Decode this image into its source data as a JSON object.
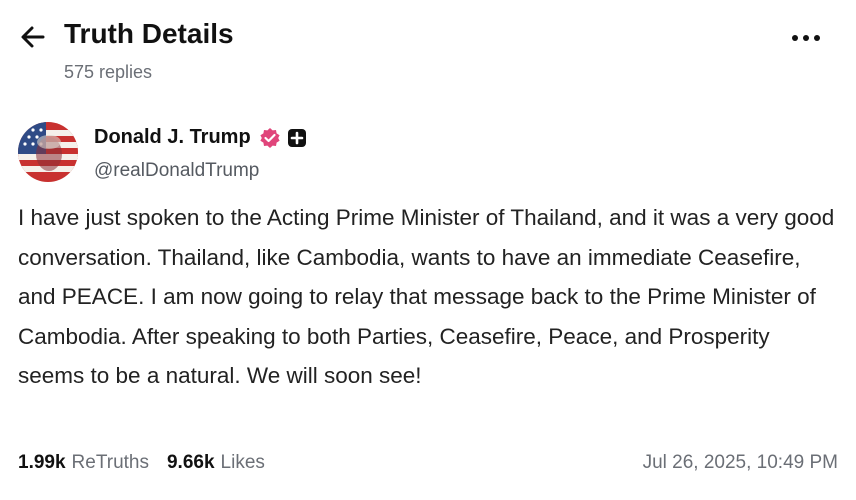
{
  "header": {
    "title": "Truth Details",
    "replies": "575 replies",
    "back_icon": "arrow-left-icon",
    "more_icon": "more-horizontal-icon"
  },
  "author": {
    "name": "Donald J. Trump",
    "handle": "@realDonaldTrump",
    "verified_icon": "verified-badge-icon",
    "plus_icon": "plus-badge-icon",
    "verified_color": "#e0457b"
  },
  "post": {
    "text": "I have just spoken to the Acting Prime Minister of Thailand, and it was a very good conversation. Thailand, like Cambodia, wants to have an immediate Ceasefire, and PEACE. I am now going to relay that message back to the Prime Minister of Cambodia. After speaking to both Parties, Ceasefire, Peace, and Prosperity seems to be a natural. We will soon see!"
  },
  "stats": {
    "retruths_count": "1.99k",
    "retruths_label": "ReTruths",
    "likes_count": "9.66k",
    "likes_label": "Likes"
  },
  "timestamp": "Jul 26, 2025, 10:49 PM"
}
